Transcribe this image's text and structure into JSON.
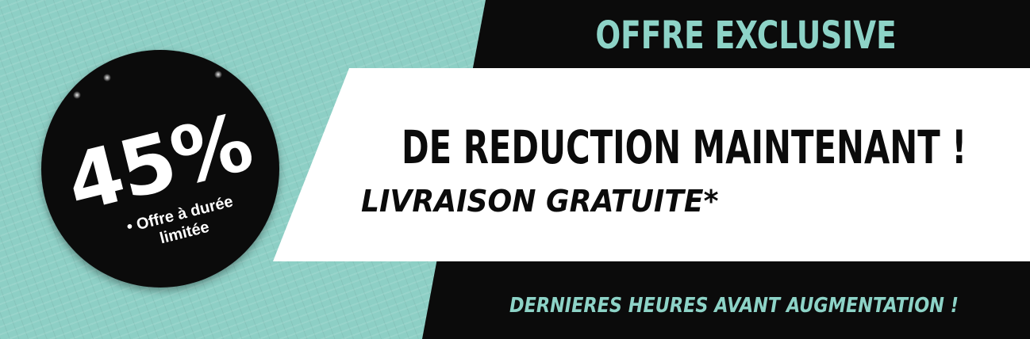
{
  "banner": {
    "offer_title": "OFFRE EXCLUSIVE",
    "main_headline": "DE REDUCTION MAINTENANT !",
    "sub_headline": "LIVRAISON GRATUITE*",
    "footer": "DERNIERES HEURES AVANT AUGMENTATION !"
  },
  "badge": {
    "percent": "45%",
    "note": "• Offre à durée limitée"
  },
  "colors": {
    "teal_background": "#8dcfc5",
    "teal_text": "#8dd3c7",
    "black": "#0b0b0b",
    "white": "#ffffff"
  }
}
